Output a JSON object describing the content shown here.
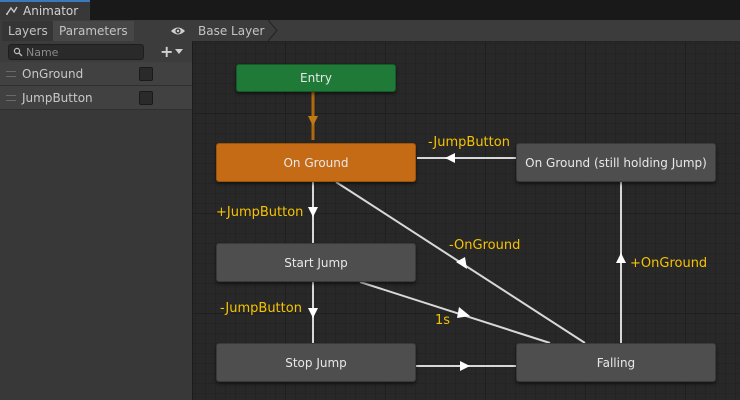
{
  "window": {
    "tab_title": "Animator",
    "tab_icon": "animator-icon"
  },
  "left_panel": {
    "tabs": [
      {
        "label": "Layers"
      },
      {
        "label": "Parameters"
      }
    ],
    "search": {
      "placeholder": "Name",
      "value": ""
    },
    "add_label": "+",
    "parameters": [
      {
        "name": "OnGround",
        "type": "bool",
        "checked": false
      },
      {
        "name": "JumpButton",
        "type": "bool",
        "checked": false
      }
    ]
  },
  "graph": {
    "breadcrumb": "Base Layer",
    "states": {
      "entry": "Entry",
      "on_ground": "On Ground",
      "on_ground_hold": "On Ground (still holding Jump)",
      "start_jump": "Start Jump",
      "stop_jump": "Stop Jump",
      "falling": "Falling"
    },
    "transitions": {
      "hold_to_ground": "-JumpButton",
      "ground_to_start": "+JumpButton",
      "ground_to_falling": "-OnGround",
      "start_to_stop": "-JumpButton",
      "start_to_falling": "1s",
      "falling_to_hold": "+OnGround"
    },
    "colors": {
      "default_state": "#4e4e4e",
      "default_state_orange": "#c56b16",
      "entry_state": "#1f7a38",
      "transition_label": "#f7c300",
      "accent": "#3a79bb"
    }
  }
}
